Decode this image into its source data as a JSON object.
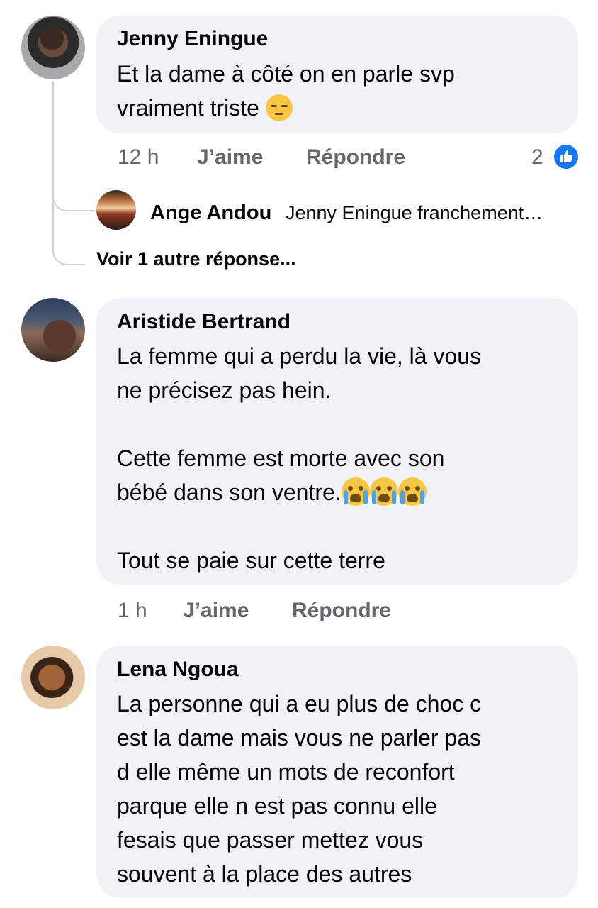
{
  "comments": [
    {
      "author": "Jenny Eningue",
      "line1": "Et la dame à côté on en parle svp",
      "line2": "vraiment triste",
      "time": "12 h",
      "like": "J’aime",
      "reply": "Répondre",
      "reaction_count": "2"
    },
    {
      "author": "Aristide Bertrand",
      "line1": "La femme qui a perdu la vie, là vous",
      "line2": "ne précisez pas hein.",
      "line3": "Cette femme est morte avec son",
      "line4": "bébé dans son ventre.",
      "line5": "Tout se paie sur cette terre",
      "time": "1 h",
      "like": "J’aime",
      "reply": "Répondre"
    },
    {
      "author": "Lena Ngoua",
      "line1": "La personne qui a eu plus de choc c",
      "line2": "est la dame mais vous ne parler pas",
      "line3": "d elle même un mots de reconfort",
      "line4": "parque elle n est pas connu elle",
      "line5": "fesais que passer mettez vous",
      "line6": "souvent à la place des autres"
    }
  ],
  "reply_preview": {
    "author": "Ange Andou",
    "text": "Jenny Eningue franchement…"
  },
  "more_replies": "Voir 1 autre réponse...",
  "colors": {
    "bubble": "#f0f2f5",
    "meta_text": "#65676b",
    "like_blue": "#1877f2",
    "emoji_yellow": "#f7c744"
  },
  "icons": [
    "like-reaction-icon",
    "sad-face-emoji",
    "crying-face-emoji"
  ]
}
